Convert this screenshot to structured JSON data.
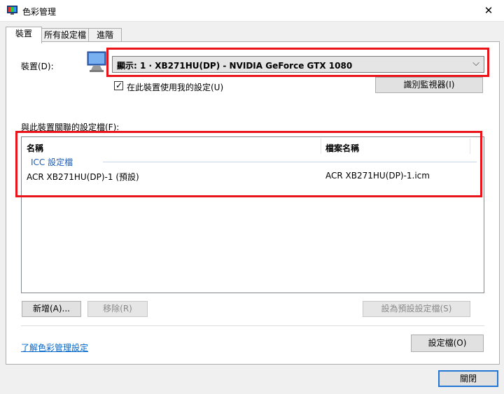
{
  "window": {
    "title": "色彩管理",
    "close_glyph": "✕",
    "icon": "color-management-icon"
  },
  "tabs": [
    {
      "label": "裝置",
      "active": true
    },
    {
      "label": "所有設定檔",
      "active": false
    },
    {
      "label": "進階",
      "active": false
    }
  ],
  "device": {
    "label": "裝置(D):",
    "selected": "顯示: 1 · XB271HU(DP) - NVIDIA GeForce GTX 1080",
    "chevron": "⌵",
    "use_my_settings_label": "在此裝置使用我的設定(U)",
    "use_my_settings_checked": true,
    "identify_button": "識別監視器(I)"
  },
  "profiles": {
    "label": "與此裝置關聯的設定檔(F):",
    "columns": [
      "名稱",
      "檔案名稱"
    ],
    "group": "ICC 設定檔",
    "rows": [
      {
        "name": "ACR XB271HU(DP)-1 (預設)",
        "file": "ACR XB271HU(DP)-1.icm"
      }
    ]
  },
  "buttons": {
    "add": "新增(A)...",
    "remove": "移除(R)",
    "set_default": "設為預設設定檔(S)",
    "profiles": "設定檔(O)",
    "close": "關閉"
  },
  "links": {
    "learn_more": "了解色彩管理設定"
  },
  "colors": {
    "highlight": "#e8141a",
    "link": "#0066cc",
    "group_header": "#1e5cb3",
    "default_button_border": "#2476d4"
  }
}
